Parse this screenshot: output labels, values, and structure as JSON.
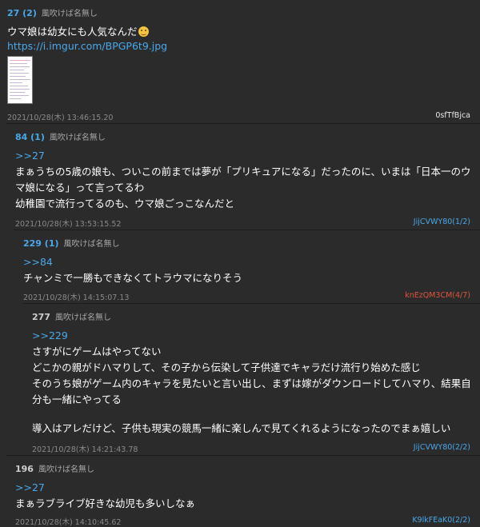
{
  "posts": [
    {
      "number": "27 (2)",
      "name": "風吹けば名無し",
      "lines": [
        "ウマ娘は幼女にも人気なんだ"
      ],
      "emoji": "hugging-face",
      "link": "https://i.imgur.com/BPGP6t9.jpg",
      "date": "2021/10/28(木) 13:46:15.20",
      "id": "0sfTfBjca",
      "id_color": "#e8e8e8"
    },
    {
      "number": "84 (1)",
      "name": "風吹けば名無し",
      "anchor": ">>27",
      "lines": [
        "まぁうちの5歳の娘も、ついこの前までは夢が「プリキュアになる」だったのに、いまは「日本一のウ",
        "マ娘になる」って言ってるわ",
        "幼稚園で流行ってるのも、ウマ娘ごっこなんだと"
      ],
      "date": "2021/10/28(木) 13:53:15.52",
      "id": "JijCVWY80(1/2)",
      "id_color": "#4aa8ea"
    },
    {
      "number": "229 (1)",
      "name": "風吹けば名無し",
      "anchor": ">>84",
      "lines": [
        "チャンミで一勝もできなくてトラウマになりそう"
      ],
      "date": "2021/10/28(木) 14:15:07.13",
      "id": "knEzQM3CM(4/7)",
      "id_color": "#e0553f"
    },
    {
      "number": "277",
      "name": "風吹けば名無し",
      "anchor": ">>229",
      "lines": [
        "さすがにゲームはやってない",
        "どこかの親がドハマりして、その子から伝染して子供達でキャラだけ流行り始めた感じ",
        "そのうち娘がゲーム内のキャラを見たいと言い出し、まずは嫁がダウンロードしてハマり、結果自",
        "分も一緒にやってる",
        "",
        "導入はアレだけど、子供も現実の競馬一緒に楽しんで見てくれるようになったのでまぁ嬉しい"
      ],
      "date": "2021/10/28(木) 14:21:43.78",
      "id": "JijCVWY80(2/2)",
      "id_color": "#4aa8ea"
    },
    {
      "number": "196",
      "name": "風吹けば名無し",
      "anchor": ">>27",
      "lines": [
        "まぁラブライブ好きな幼児も多いしなぁ"
      ],
      "date": "2021/10/28(木) 14:10:45.62",
      "id": "K9lkFEaK0(2/2)",
      "id_color": "#4aa8ea"
    }
  ]
}
